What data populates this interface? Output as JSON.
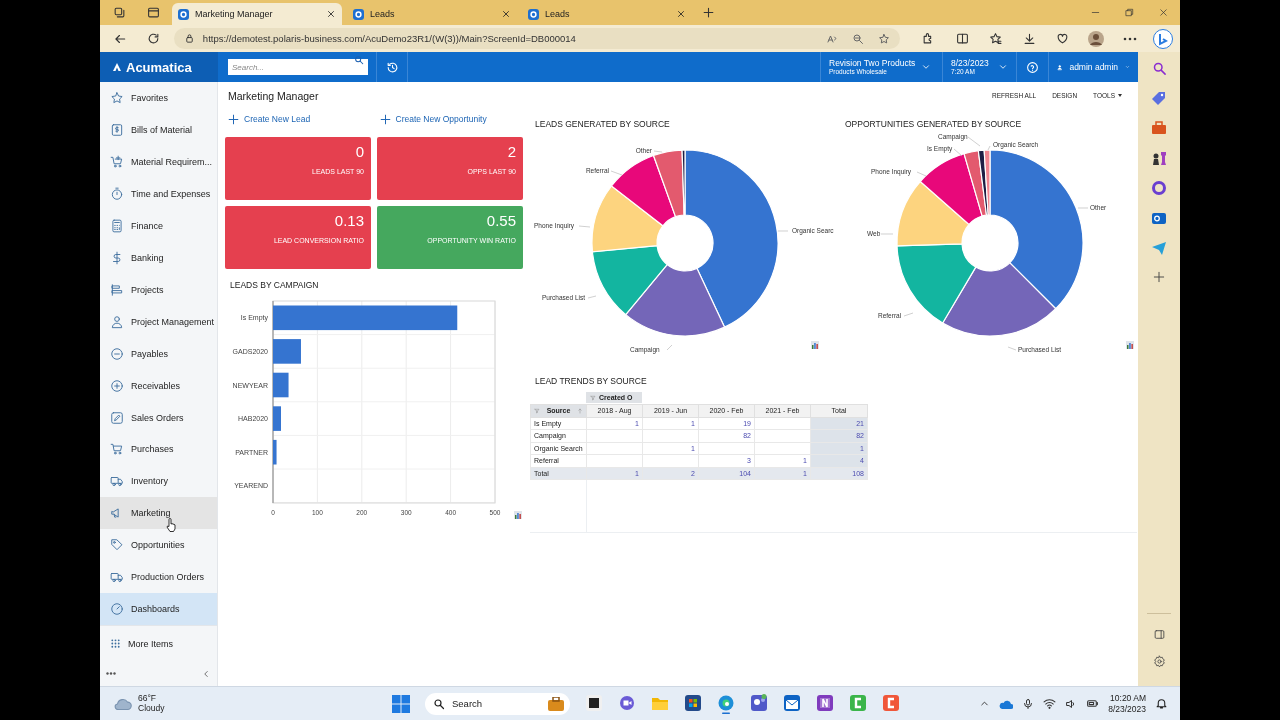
{
  "browser": {
    "tabs": [
      {
        "title": "Marketing Manager",
        "selected": true
      },
      {
        "title": "Leads",
        "selected": false
      },
      {
        "title": "Leads",
        "selected": false
      }
    ],
    "url": "https://demotest.polaris-business.com/AcuDemo23R1/(W(3))/Main?ScreenId=DB000014"
  },
  "header": {
    "logo": "Acumatica",
    "search": {
      "placeholder": "Search..."
    },
    "company": {
      "name": "Revision Two Products",
      "branch": "Products Wholesale"
    },
    "date": {
      "date": "8/23/2023",
      "time": "7:20 AM"
    },
    "user": "admin admin"
  },
  "sidebar": {
    "items": [
      {
        "label": "Favorites",
        "selected": false,
        "hovered": false
      },
      {
        "label": "Bills of Material",
        "selected": false,
        "hovered": false
      },
      {
        "label": "Material Requirem...",
        "selected": false,
        "hovered": false
      },
      {
        "label": "Time and Expenses",
        "selected": false,
        "hovered": false
      },
      {
        "label": "Finance",
        "selected": false,
        "hovered": false
      },
      {
        "label": "Banking",
        "selected": false,
        "hovered": false
      },
      {
        "label": "Projects",
        "selected": false,
        "hovered": false
      },
      {
        "label": "Project Management",
        "selected": false,
        "hovered": false
      },
      {
        "label": "Payables",
        "selected": false,
        "hovered": false
      },
      {
        "label": "Receivables",
        "selected": false,
        "hovered": false
      },
      {
        "label": "Sales Orders",
        "selected": false,
        "hovered": false
      },
      {
        "label": "Purchases",
        "selected": false,
        "hovered": false
      },
      {
        "label": "Inventory",
        "selected": false,
        "hovered": false
      },
      {
        "label": "Marketing",
        "selected": false,
        "hovered": true
      },
      {
        "label": "Opportunities",
        "selected": false,
        "hovered": false
      },
      {
        "label": "Production Orders",
        "selected": false,
        "hovered": false
      },
      {
        "label": "Dashboards",
        "selected": true,
        "hovered": false
      }
    ],
    "more": "More Items"
  },
  "page": {
    "title": "Marketing Manager",
    "toolbar": [
      "REFRESH ALL",
      "DESIGN",
      "TOOLS"
    ],
    "actions": [
      "Create New Lead",
      "Create New Opportunity"
    ],
    "tiles": [
      {
        "value": "0",
        "label": "LEADS LAST 90",
        "color": "#e5404f"
      },
      {
        "value": "2",
        "label": "OPPS LAST 90",
        "color": "#e5404f"
      },
      {
        "value": "0.13",
        "label": "LEAD CONVERSION RATIO",
        "color": "#e5404f"
      },
      {
        "value": "0.55",
        "label": "OPPORTUNITY WIN RATIO",
        "color": "#45a85e"
      }
    ],
    "leads_by_campaign": {
      "chart_data": {
        "type": "bar",
        "orientation": "horizontal",
        "title": "LEADS BY CAMPAIGN",
        "categories": [
          "Is Empty",
          "GADS2020",
          "NEWYEAR",
          "HAB2020",
          "PARTNER",
          "YEAREND"
        ],
        "values": [
          415,
          63,
          35,
          18,
          8,
          0
        ],
        "grid": true,
        "xlim": [
          0,
          500
        ],
        "xticks": [
          0,
          100,
          200,
          300,
          400,
          500
        ]
      }
    },
    "leads_by_source": {
      "title": "LEADS GENERATED BY SOURCE",
      "labels": [
        "Other",
        "Referral",
        "Phone Inquiry",
        "Purchased List",
        "Campaign",
        "Organic Searc"
      ]
    },
    "opportunities_by_source": {
      "title": "OPPORTUNITIES GENERATED BY SOURCE",
      "labels": [
        "Campaign",
        "Is Empty",
        "Organic Search",
        "Phone Inquiry",
        "Other",
        "Web",
        "Referral",
        "Purchased List"
      ]
    },
    "lead_trends": {
      "title": "LEAD TRENDS BY SOURCE",
      "column_group": "Created O",
      "columns": [
        "Source",
        "2018 - Aug",
        "2019 - Jun",
        "2020 - Feb",
        "2021 - Feb",
        "Total"
      ],
      "rows": [
        {
          "kind": "data",
          "cells": [
            "Is Empty",
            "1",
            "1",
            "19",
            null,
            "21"
          ]
        },
        {
          "kind": "data",
          "cells": [
            "Campaign",
            null,
            null,
            "82",
            null,
            "82"
          ]
        },
        {
          "kind": "data",
          "cells": [
            "Organic Search",
            null,
            "1",
            null,
            null,
            "1"
          ]
        },
        {
          "kind": "data",
          "cells": [
            "Referral",
            null,
            null,
            "3",
            "1",
            "4"
          ]
        },
        {
          "kind": "total",
          "cells": [
            "Total",
            "1",
            "2",
            "104",
            "1",
            "108"
          ]
        }
      ]
    }
  },
  "taskbar": {
    "weather": {
      "temperature": "66°F",
      "condition": "Cloudy"
    },
    "search": "Search",
    "time": "10:20 AM",
    "date": "8/23/2023"
  }
}
